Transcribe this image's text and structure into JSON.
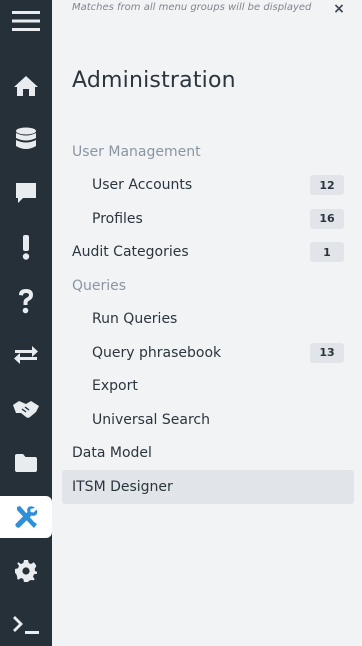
{
  "topbar": {
    "hint": "Matches from all menu groups will be displayed",
    "close": "×"
  },
  "rail": {
    "items": [
      {
        "icon": "hamburger-menu-icon"
      },
      {
        "icon": "home-icon"
      },
      {
        "icon": "database-icon"
      },
      {
        "icon": "chat-icon"
      },
      {
        "icon": "exclamation-icon"
      },
      {
        "icon": "question-icon"
      },
      {
        "icon": "exchange-arrows-icon"
      },
      {
        "icon": "handshake-icon"
      },
      {
        "icon": "folder-icon"
      },
      {
        "icon": "wrench-screwdriver-icon",
        "active": true
      },
      {
        "icon": "gear-icon"
      },
      {
        "icon": "terminal-icon"
      }
    ]
  },
  "panel": {
    "title": "Administration",
    "menu": [
      {
        "label": "User Management",
        "kind": "group"
      },
      {
        "label": "User Accounts",
        "kind": "item",
        "badge": "12"
      },
      {
        "label": "Profiles",
        "kind": "item",
        "badge": "16"
      },
      {
        "label": "Audit Categories",
        "kind": "top",
        "badge": "1"
      },
      {
        "label": "Queries",
        "kind": "group"
      },
      {
        "label": "Run Queries",
        "kind": "item"
      },
      {
        "label": "Query phrasebook",
        "kind": "item",
        "badge": "13"
      },
      {
        "label": "Export",
        "kind": "item"
      },
      {
        "label": "Universal Search",
        "kind": "item"
      },
      {
        "label": "Data Model",
        "kind": "top"
      },
      {
        "label": "ITSM Designer",
        "kind": "top",
        "active": true
      }
    ]
  },
  "colors": {
    "rail_bg": "#263039",
    "panel_bg": "#f2f3f5",
    "active_icon": "#2f8fd8",
    "group_text": "#8a96a3"
  }
}
